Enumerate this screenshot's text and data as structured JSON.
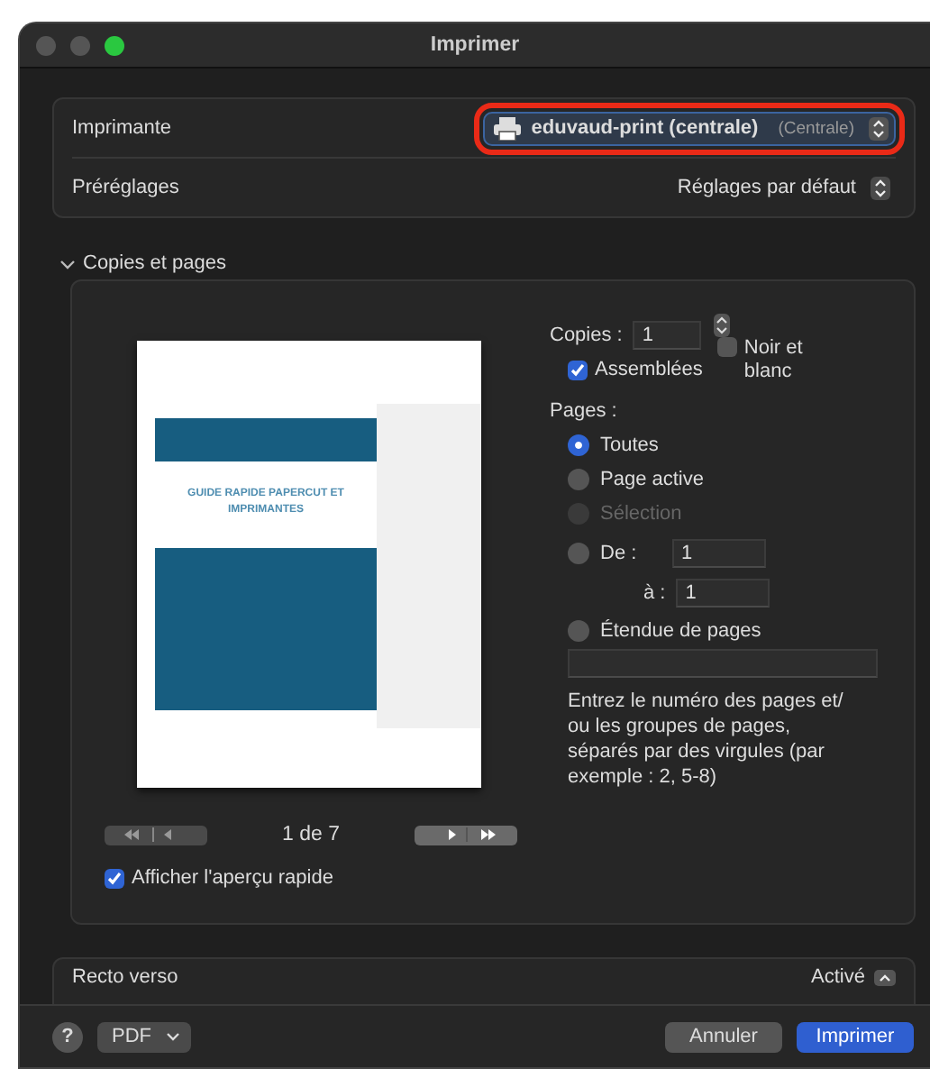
{
  "window": {
    "title": "Imprimer"
  },
  "printer": {
    "label": "Imprimante",
    "value": "eduvaud-print (centrale)",
    "location": "(Centrale)",
    "highlighted": true
  },
  "presets": {
    "label": "Préréglages",
    "value": "Réglages par défaut"
  },
  "section": {
    "title": "Copies et pages",
    "expanded": true
  },
  "preview": {
    "document_title": "GUIDE RAPIDE PAPERCUT ET IMPRIMANTES",
    "page_indicator": "1 de 7"
  },
  "show_preview": {
    "label": "Afficher l'aperçu rapide",
    "checked": true
  },
  "copies": {
    "label": "Copies :",
    "value": "1"
  },
  "collated": {
    "label": "Assemblées",
    "checked": true
  },
  "black_white": {
    "label": "Noir et blanc",
    "checked": false
  },
  "pages": {
    "label": "Pages :",
    "options": [
      {
        "kind": "plain",
        "label": "Toutes",
        "selected": true,
        "disabled": false
      },
      {
        "kind": "plain",
        "label": "Page active",
        "selected": false,
        "disabled": false
      },
      {
        "kind": "plain",
        "label": "Sélection",
        "selected": false,
        "disabled": true
      },
      {
        "kind": "from",
        "label": "De :",
        "value": "1",
        "to_label": "à :",
        "to_value": "1",
        "selected": false,
        "disabled": false
      },
      {
        "kind": "range",
        "label": "Étendue de pages",
        "selected": false,
        "disabled": false
      }
    ],
    "hint": "Entrez le numéro des pages et/ ou les groupes de pages, séparés par des virgules (par exemple : 2, 5-8)"
  },
  "duplex": {
    "label": "Recto verso",
    "value": "Activé"
  },
  "footer": {
    "help": "?",
    "pdf": "PDF",
    "buttons": [
      {
        "label": "Annuler",
        "kind": "cancel"
      },
      {
        "label": "Imprimer",
        "kind": "default"
      }
    ]
  }
}
